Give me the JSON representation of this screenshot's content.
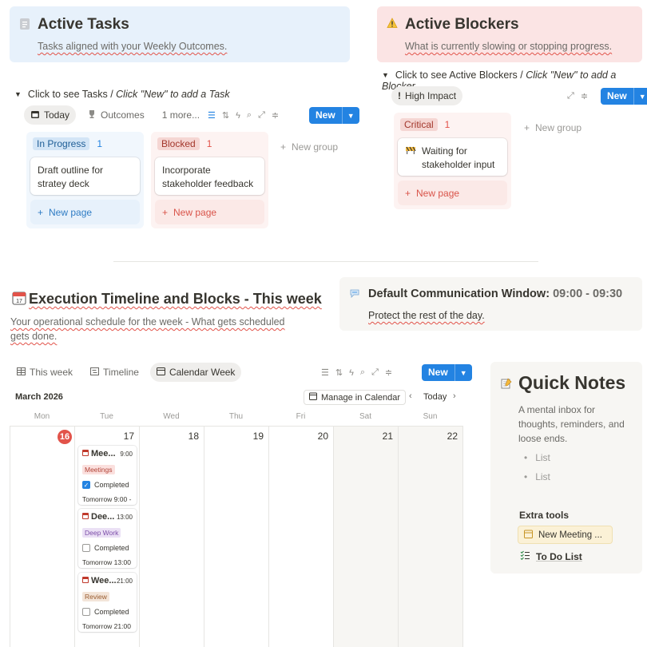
{
  "tasks_callout": {
    "icon": "notes-icon",
    "title": "Active Tasks",
    "subtitle": "Tasks aligned with your Weekly Outcomes."
  },
  "blockers_callout": {
    "icon": "warning-icon",
    "title": "Active Blockers",
    "subtitle": "What is currently slowing or stopping progress."
  },
  "tasks_toggle": {
    "lead": "Click to see Tasks / ",
    "hint": "Click \"New\" to add a Task"
  },
  "blockers_toggle": {
    "lead": "Click to see Active Blockers / ",
    "hint": "Click \"New\" to add a Blocker"
  },
  "tasks_view": {
    "tabs": [
      {
        "label": "Today",
        "icon": "calendar-icon",
        "active": true
      },
      {
        "label": "Outcomes",
        "icon": "trophy-icon",
        "active": false
      },
      {
        "label": "1 more...",
        "icon": "",
        "active": false
      }
    ],
    "new_label": "New",
    "new_group_label": "New group",
    "columns": [
      {
        "status": "In Progress",
        "count": "1",
        "card": "Draft outline for stratey deck",
        "new_page": "New page"
      },
      {
        "status": "Blocked",
        "count": "1",
        "card": "Incorporate stakeholder feedback",
        "new_page": "New page"
      }
    ]
  },
  "blockers_view": {
    "tab": "High Impact",
    "new_label": "New",
    "new_group_label": "New group",
    "column": {
      "status": "Critical",
      "count": "1",
      "card": "Waiting for stakeholder input",
      "new_page": "New page"
    }
  },
  "timeline": {
    "icon": "calendar-icon",
    "title": "Execution Timeline and Blocks - This week",
    "subtitle": "Your operational schedule for the week - What gets scheduled gets done."
  },
  "comm_window": {
    "icon": "speech-bubble-icon",
    "label": "Default Communication Window:",
    "time": "09:00 - 09:30",
    "sub": "Protect the rest of the day."
  },
  "calendar_view": {
    "tabs": [
      {
        "label": "This week",
        "icon": "table-icon",
        "active": false
      },
      {
        "label": "Timeline",
        "icon": "timeline-icon",
        "active": false
      },
      {
        "label": "Calendar Week",
        "icon": "calendar-icon",
        "active": true
      }
    ],
    "new_label": "New",
    "month": "March 2026",
    "manage_label": "Manage in Calendar",
    "today_label": "Today",
    "days": [
      {
        "dow": "Mon",
        "num": "16",
        "today": true
      },
      {
        "dow": "Tue",
        "num": "17",
        "today": false
      },
      {
        "dow": "Wed",
        "num": "18",
        "today": false
      },
      {
        "dow": "Thu",
        "num": "19",
        "today": false
      },
      {
        "dow": "Fri",
        "num": "20",
        "today": false
      },
      {
        "dow": "Sat",
        "num": "21",
        "today": false
      },
      {
        "dow": "Sun",
        "num": "22",
        "today": false
      }
    ],
    "events": [
      {
        "title": "Mee...",
        "time": "9:00",
        "tag": "Meetings",
        "completed": true,
        "check_label": "Completed",
        "footer": "Tomorrow 9:00 -"
      },
      {
        "title": "Dee...",
        "time": "13:00",
        "tag": "Deep Work",
        "completed": false,
        "check_label": "Completed",
        "footer": "Tomorrow 13:00"
      },
      {
        "title": "Wee...",
        "time": "21:00",
        "tag": "Review",
        "completed": false,
        "check_label": "Completed",
        "footer": "Tomorrow 21:00"
      }
    ]
  },
  "quick_notes": {
    "icon": "memo-icon",
    "title": "Quick Notes",
    "desc": "A mental inbox for thoughts, reminders, and loose ends.",
    "list_items": [
      "List",
      "List"
    ],
    "extra_label": "Extra tools",
    "new_meeting": "New Meeting ...",
    "todo": "To Do List"
  },
  "colors": {
    "accent": "#2383e2",
    "blue_callout": "#e7f1fb",
    "red_callout": "#fbe4e4",
    "today_badge": "#e2534a"
  }
}
